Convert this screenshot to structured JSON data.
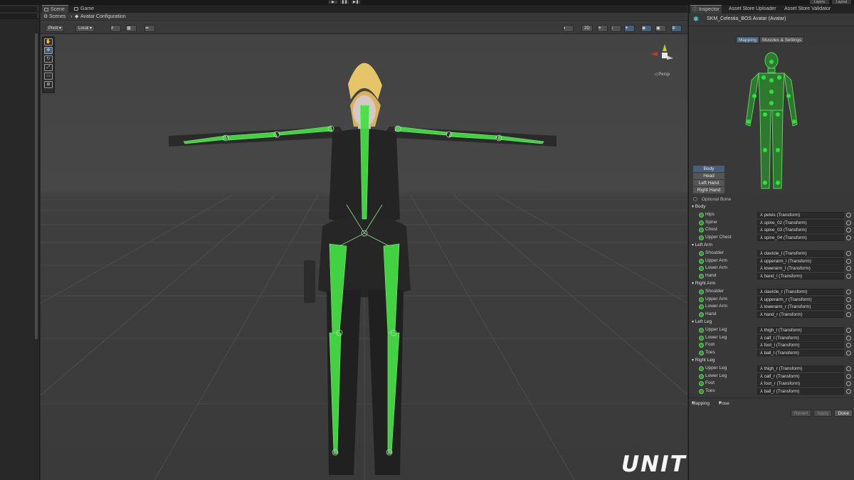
{
  "scene": {
    "tabs": [
      {
        "label": "Scene"
      },
      {
        "label": "Game"
      }
    ],
    "breadcrumb": {
      "root": "Scenes",
      "current": "Avatar Configuration"
    },
    "toolbar": {
      "pivot": "Pivot",
      "local": "Local",
      "mode2d": "2D"
    },
    "gizmo": {
      "projection": "Persp"
    }
  },
  "watermark": "UNITY PROJECT",
  "inspector": {
    "tabs": [
      {
        "label": "Inspector"
      },
      {
        "label": "Asset Store Uploader"
      },
      {
        "label": "Asset Store Validator"
      }
    ],
    "title": "SKM_Celestia_BOS Avatar (Avatar)",
    "mode_tabs": [
      {
        "label": "Mapping"
      },
      {
        "label": "Muscles & Settings"
      }
    ],
    "body_parts": [
      {
        "label": "Body"
      },
      {
        "label": "Head"
      },
      {
        "label": "Left Hand"
      },
      {
        "label": "Right Hand"
      }
    ],
    "optional_bone": "Optional Bone",
    "groups": [
      {
        "name": "Body",
        "bones": [
          {
            "name": "Hips",
            "value": "pelvis (Transform)"
          },
          {
            "name": "Spine",
            "value": "spine_02 (Transform)"
          },
          {
            "name": "Chest",
            "value": "spine_03 (Transform)"
          },
          {
            "name": "Upper Chest",
            "value": "spine_04 (Transform)"
          }
        ]
      },
      {
        "name": "Left Arm",
        "bones": [
          {
            "name": "Shoulder",
            "value": "clavicle_l (Transform)"
          },
          {
            "name": "Upper Arm",
            "value": "upperarm_l (Transform)"
          },
          {
            "name": "Lower Arm",
            "value": "lowerarm_l (Transform)"
          },
          {
            "name": "Hand",
            "value": "hand_l (Transform)"
          }
        ]
      },
      {
        "name": "Right Arm",
        "bones": [
          {
            "name": "Shoulder",
            "value": "clavicle_r (Transform)"
          },
          {
            "name": "Upper Arm",
            "value": "upperarm_r (Transform)"
          },
          {
            "name": "Lower Arm",
            "value": "lowerarm_r (Transform)"
          },
          {
            "name": "Hand",
            "value": "hand_r (Transform)"
          }
        ]
      },
      {
        "name": "Left Leg",
        "bones": [
          {
            "name": "Upper Leg",
            "value": "thigh_l (Transform)"
          },
          {
            "name": "Lower Leg",
            "value": "calf_l (Transform)"
          },
          {
            "name": "Foot",
            "value": "foot_l (Transform)"
          },
          {
            "name": "Toes",
            "value": "ball_l (Transform)"
          }
        ]
      },
      {
        "name": "Right Leg",
        "bones": [
          {
            "name": "Upper Leg",
            "value": "thigh_r (Transform)"
          },
          {
            "name": "Lower Leg",
            "value": "calf_r (Transform)"
          },
          {
            "name": "Foot",
            "value": "foot_r (Transform)"
          },
          {
            "name": "Toes",
            "value": "ball_r (Transform)"
          }
        ]
      }
    ],
    "footer": {
      "mapping": "Mapping",
      "pose": "Pose"
    },
    "actions": {
      "revert": "Revert",
      "apply": "Apply",
      "done": "Done"
    }
  },
  "topbar": {
    "layers": "Layers",
    "layout": "Layout"
  },
  "colors": {
    "bone_green": "#3cf03c",
    "accent": "#46607c",
    "background": "#454545"
  }
}
